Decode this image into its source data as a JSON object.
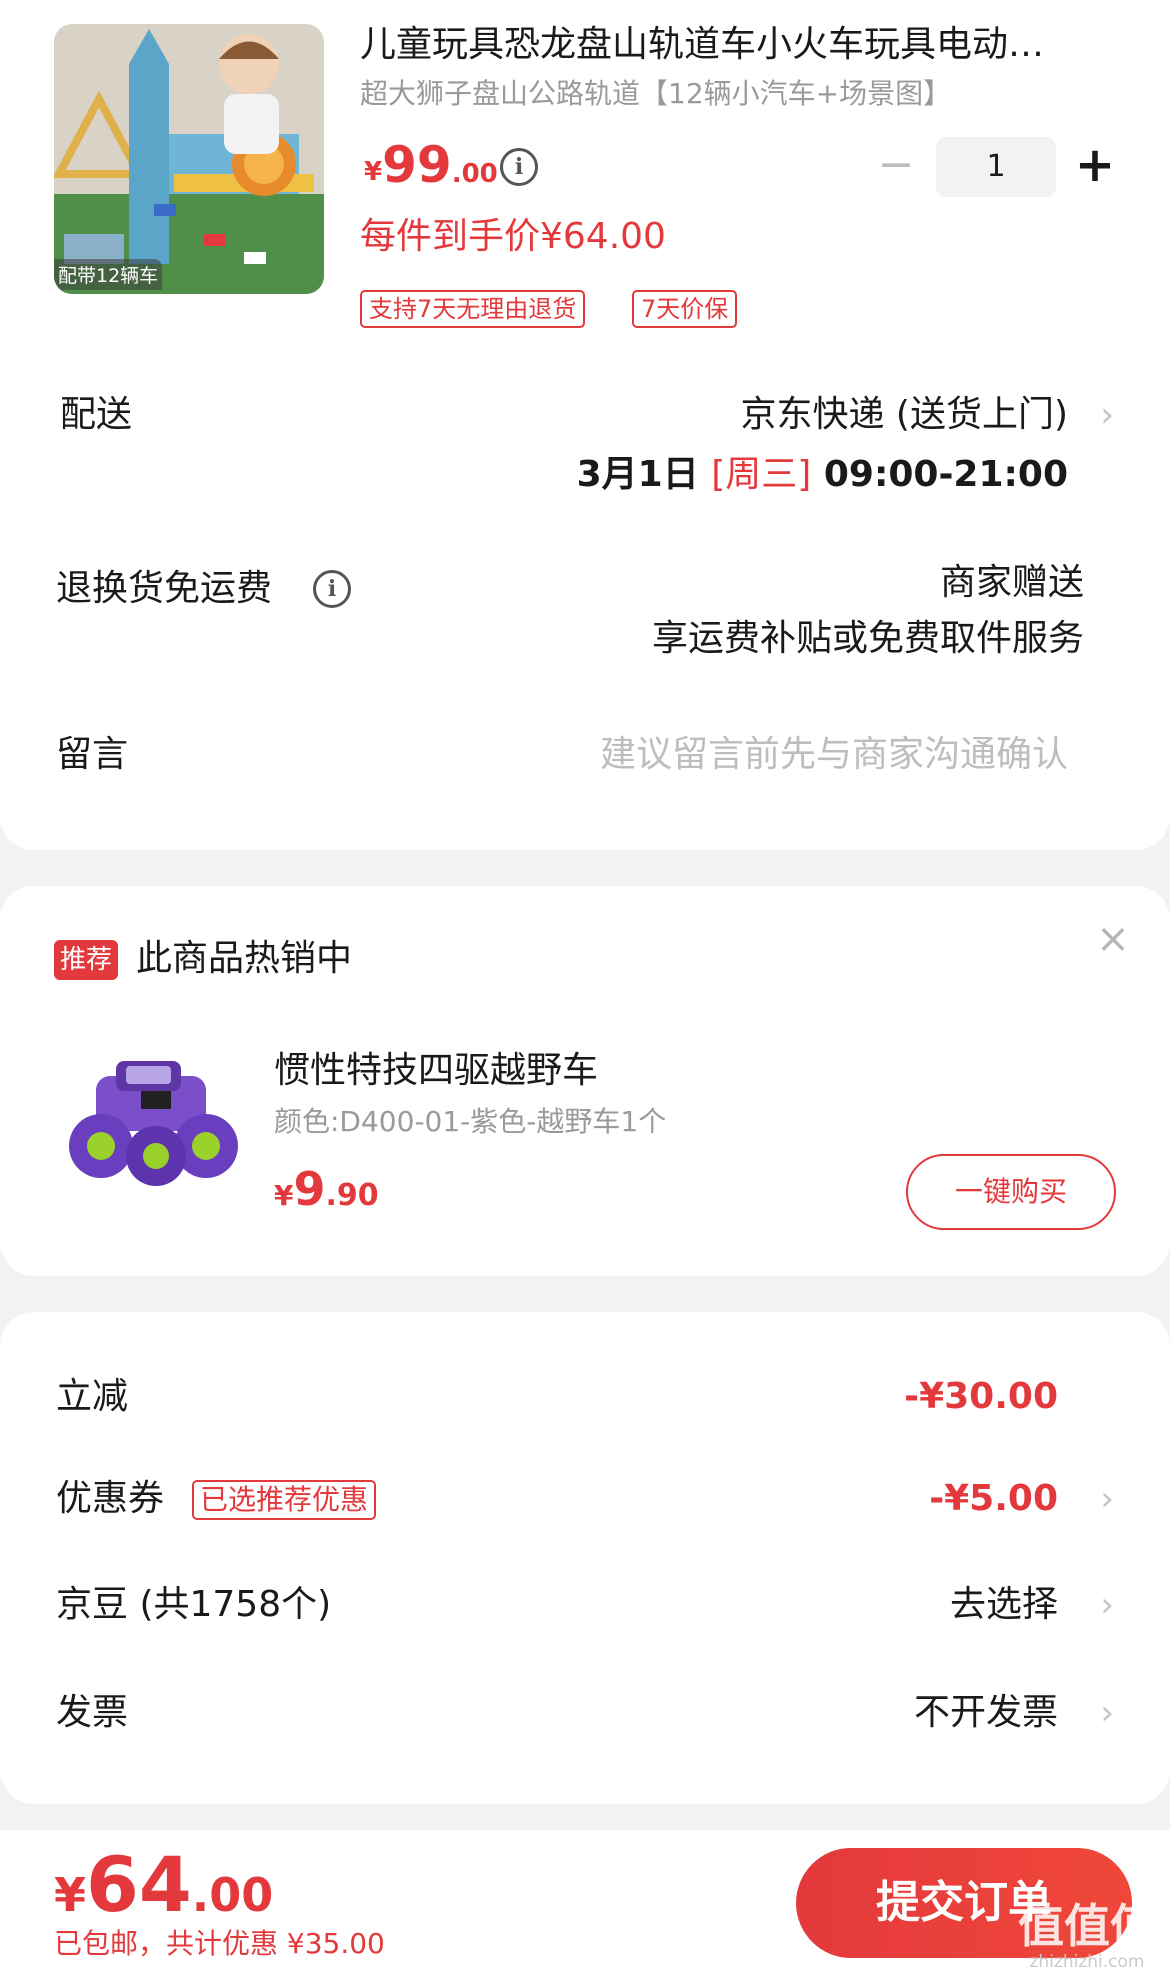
{
  "product": {
    "image_caption": "配带12辆车",
    "title": "儿童玩具恐龙盘山轨道车小火车玩具电动…",
    "spec": "超大狮子盘山公路轨道【12辆小汽车+场景图】",
    "price_currency": "¥",
    "price_int": "99",
    "price_dec": ".00",
    "qty_minus": "−",
    "quantity": "1",
    "qty_plus": "+",
    "net_price": "每件到手价¥64.00",
    "tags": [
      "支持7天无理由退货",
      "7天价保"
    ]
  },
  "delivery": {
    "label": "配送",
    "method": "京东快递 (送货上门)",
    "date": "3月1日 ",
    "weekday": "[周三]",
    "time": " 09:00-21:00"
  },
  "returns": {
    "label": "退换货免运费",
    "value_line1": "商家赠送",
    "value_line2": "享运费补贴或免费取件服务"
  },
  "remark": {
    "label": "留言",
    "placeholder": "建议留言前先与商家沟通确认"
  },
  "recommend": {
    "badge": "推荐",
    "title": "此商品热销中",
    "close": "×",
    "name": "惯性特技四驱越野车",
    "spec": "颜色:D400-01-紫色-越野车1个",
    "price_currency": "¥",
    "price_int": "9",
    "price_dec": ".90",
    "buy_label": "一键购买"
  },
  "discounts": {
    "instant_label": "立减",
    "instant_value": "-¥30.00",
    "coupon_label": "优惠券",
    "coupon_tag": "已选推荐优惠",
    "coupon_value": "-¥5.00",
    "jingdou_label": "京豆 (共1758个)",
    "jingdou_value": "去选择",
    "invoice_label": "发票",
    "invoice_value": "不开发票"
  },
  "footer": {
    "total_currency": "¥",
    "total_int": "64",
    "total_dec": ".00",
    "summary": "已包邮，共计优惠 ¥35.00",
    "submit_label": "提交订单",
    "watermark_logo": "值值值",
    "watermark_url": "zhizhizhi.com"
  },
  "colors": {
    "accent": "#e4393c",
    "background": "#f2f2f2",
    "muted_text": "#9a9a9a"
  },
  "icons": [
    "info-icon",
    "chevron-right-icon",
    "close-icon",
    "minus-icon",
    "plus-icon"
  ]
}
